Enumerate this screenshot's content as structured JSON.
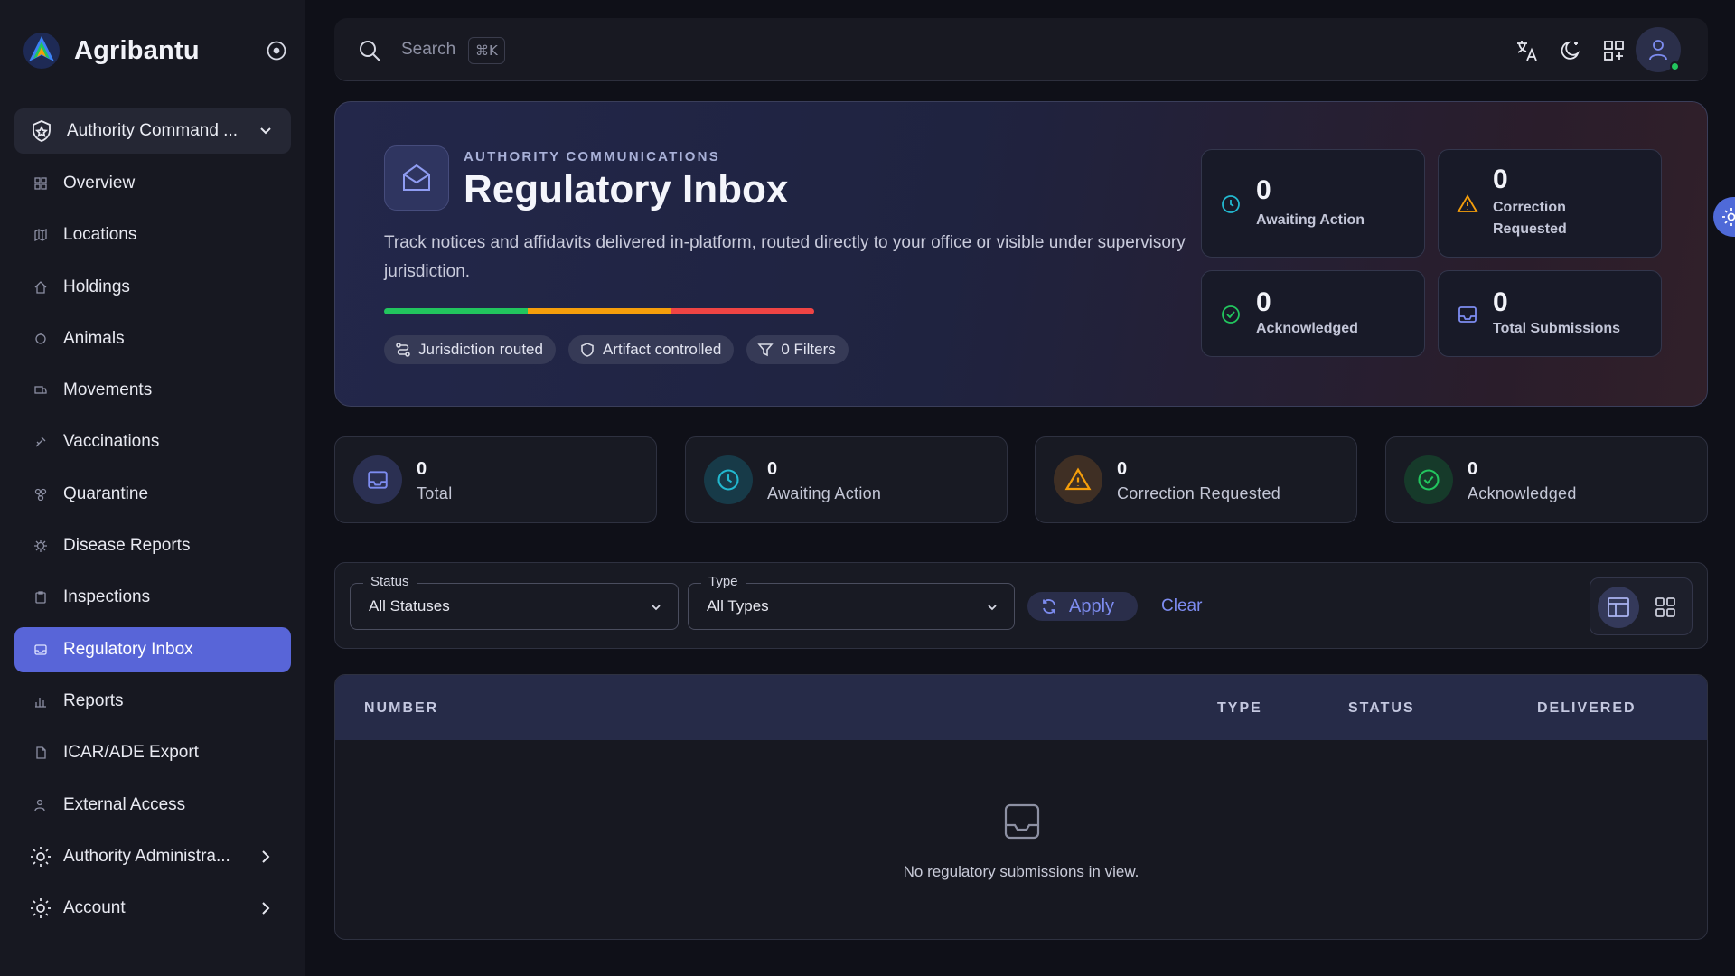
{
  "app": {
    "name": "Agribantu"
  },
  "sidebar": {
    "group_label": "Authority Command ...",
    "items": [
      {
        "label": "Overview"
      },
      {
        "label": "Locations"
      },
      {
        "label": "Holdings"
      },
      {
        "label": "Animals"
      },
      {
        "label": "Movements"
      },
      {
        "label": "Vaccinations"
      },
      {
        "label": "Quarantine"
      },
      {
        "label": "Disease Reports"
      },
      {
        "label": "Inspections"
      },
      {
        "label": "Regulatory Inbox"
      },
      {
        "label": "Reports"
      },
      {
        "label": "ICAR/ADE Export"
      },
      {
        "label": "External Access"
      },
      {
        "label": "Authority Administra..."
      },
      {
        "label": "Account"
      }
    ],
    "active_item": "Regulatory Inbox"
  },
  "topbar": {
    "search_placeholder": "Search",
    "search_shortcut": "⌘K",
    "icons": [
      "translate-icon",
      "moon-icon",
      "apps-icon",
      "user-icon"
    ]
  },
  "hero": {
    "overline": "AUTHORITY COMMUNICATIONS",
    "title": "Regulatory Inbox",
    "description": "Track notices and affidavits delivered in-platform, routed directly to your office or visible under supervisory jurisdiction.",
    "chips": [
      {
        "label": "Jurisdiction routed"
      },
      {
        "label": "Artifact controlled"
      },
      {
        "label": "0 Filters"
      }
    ],
    "summary": [
      {
        "value": "0",
        "label": "Awaiting Action"
      },
      {
        "value": "0",
        "label": "Correction Requested"
      },
      {
        "value": "0",
        "label": "Acknowledged"
      },
      {
        "value": "0",
        "label": "Total Submissions"
      }
    ]
  },
  "stats": [
    {
      "value": "0",
      "label": "Total"
    },
    {
      "value": "0",
      "label": "Awaiting Action"
    },
    {
      "value": "0",
      "label": "Correction Requested"
    },
    {
      "value": "0",
      "label": "Acknowledged"
    }
  ],
  "filters": {
    "status": {
      "legend": "Status",
      "value": "All Statuses"
    },
    "type": {
      "legend": "Type",
      "value": "All Types"
    },
    "apply_label": "Apply",
    "clear_label": "Clear"
  },
  "table": {
    "columns": [
      "NUMBER",
      "TYPE",
      "STATUS",
      "DELIVERED"
    ],
    "rows": [],
    "empty_message": "No regulatory submissions in view."
  },
  "colors": {
    "accent": "#5865d8",
    "link": "#7d8cf0",
    "status_green": "#22c55e",
    "status_orange": "#f59e0b",
    "status_red": "#ef4444",
    "status_teal": "#22b8cf"
  }
}
